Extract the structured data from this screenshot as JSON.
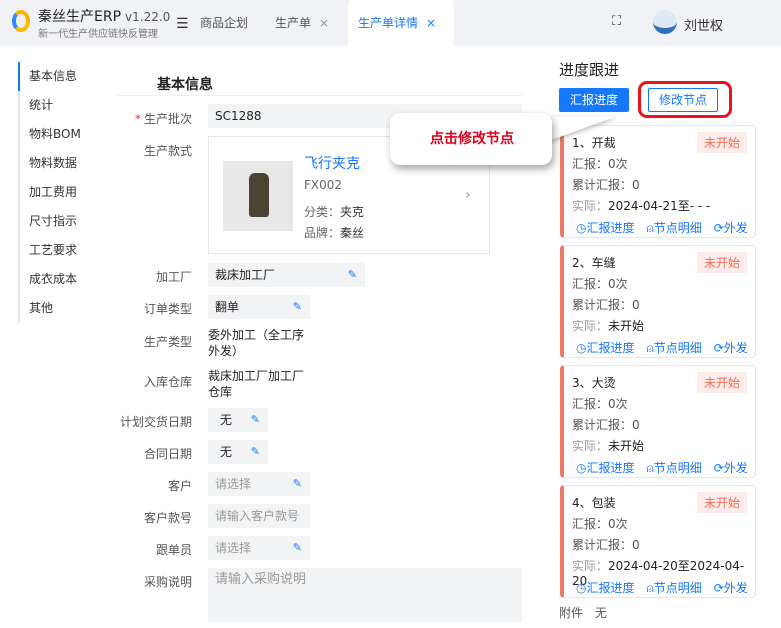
{
  "app": {
    "title": "秦丝生产ERP",
    "version": "v1.22.0",
    "subtitle": "新一代生产供应链快反管理",
    "user": "刘世权"
  },
  "tabs": [
    {
      "label": "商品企划"
    },
    {
      "label": "生产单",
      "close": "×"
    },
    {
      "label": "生产单详情",
      "close": "×"
    }
  ],
  "nav": [
    "基本信息",
    "统计",
    "物料BOM",
    "物料数据",
    "加工费用",
    "尺寸指示",
    "工艺要求",
    "成衣成本",
    "其他"
  ],
  "form": {
    "section": "基本信息",
    "batch_label": "生产批次",
    "batch": "SC1288",
    "style_label": "生产款式",
    "style_name": "飞行夹克",
    "style_code": "FX002",
    "category_label": "分类：",
    "category": "夹克",
    "brand_label": "品牌：",
    "brand": "秦丝",
    "factory_label": "加工厂",
    "factory": "裁床加工厂",
    "order_type_label": "订单类型",
    "order_type": "翻单",
    "prod_type_label": "生产类型",
    "prod_type": "委外加工（全工序外发）",
    "warehouse_label": "入库仓库",
    "warehouse": "裁床加工厂加工厂仓库",
    "delivery_label": "计划交货日期",
    "delivery": "无",
    "contract_label": "合同日期",
    "contract": "无",
    "customer_label": "客户",
    "customer_ph": "请选择",
    "cust_no_label": "客户款号",
    "cust_no_ph": "请输入客户款号",
    "follower_label": "跟单员",
    "follower_ph": "请选择",
    "purchase_label": "采购说明",
    "purchase_ph": "请输入采购说明"
  },
  "progress": {
    "title": "进度跟进",
    "report_btn": "汇报进度",
    "edit_btn": "修改节点",
    "tooltip": "点击修改节点",
    "report_label": "汇报：",
    "total_label": "累计汇报：",
    "actual_label": "实际：",
    "actions": [
      "汇报进度",
      "节点明细",
      "外发"
    ],
    "nodes": [
      {
        "name": "1、开裁",
        "status": "未开始",
        "report": "0次",
        "total": "0",
        "actual": "2024-04-21至- - -"
      },
      {
        "name": "2、车缝",
        "status": "未开始",
        "report": "0次",
        "total": "0",
        "actual": "未开始"
      },
      {
        "name": "3、大烫",
        "status": "未开始",
        "report": "0次",
        "total": "0",
        "actual": "未开始"
      },
      {
        "name": "4、包装",
        "status": "未开始",
        "report": "0次",
        "total": "0",
        "actual": "2024-04-20至2024-04-20"
      }
    ],
    "attach_label": "附件",
    "attach": "无"
  }
}
